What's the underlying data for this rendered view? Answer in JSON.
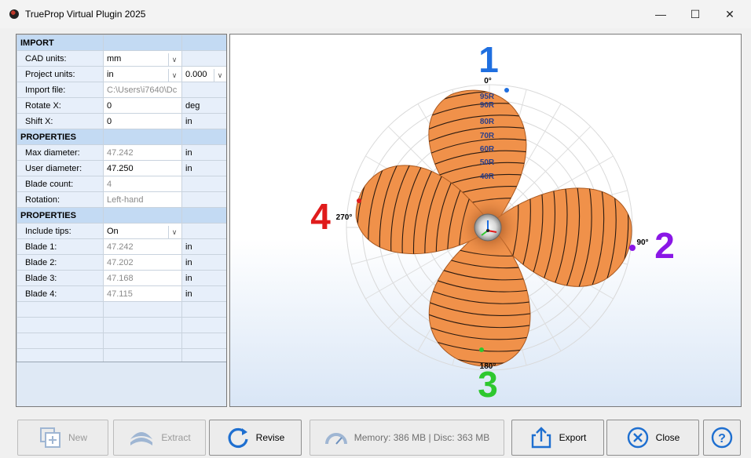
{
  "window": {
    "title": "TrueProp Virtual Plugin 2025"
  },
  "titlebar_buttons": {
    "minimize": "—",
    "maximize": "☐",
    "close": "✕"
  },
  "property_grid": {
    "rows": [
      {
        "type": "section",
        "label": "IMPORT"
      },
      {
        "type": "field",
        "label": "CAD units:",
        "value": "mm",
        "dropdown": true,
        "unit": ""
      },
      {
        "type": "field",
        "label": "Project units:",
        "value": "in",
        "dropdown": true,
        "unit": "0.000",
        "unit_dropdown": true
      },
      {
        "type": "field",
        "label": "Import file:",
        "value": "C:\\Users\\i7640\\Dc",
        "readonly": true,
        "unit": ""
      },
      {
        "type": "field",
        "label": "Rotate X:",
        "value": "0",
        "unit": "deg"
      },
      {
        "type": "field",
        "label": "Shift X:",
        "value": "0",
        "unit": "in"
      },
      {
        "type": "section",
        "label": "PROPERTIES"
      },
      {
        "type": "field",
        "label": "Max diameter:",
        "value": "47.242",
        "readonly": true,
        "unit": "in"
      },
      {
        "type": "field",
        "label": "User diameter:",
        "value": "47.250",
        "unit": "in"
      },
      {
        "type": "field",
        "label": "Blade count:",
        "value": "4",
        "readonly": true,
        "unit": ""
      },
      {
        "type": "field",
        "label": "Rotation:",
        "value": "Left-hand",
        "readonly": true,
        "unit": ""
      },
      {
        "type": "section",
        "label": "PROPERTIES"
      },
      {
        "type": "field",
        "label": "Include tips:",
        "value": "On",
        "dropdown": true,
        "unit": ""
      },
      {
        "type": "field",
        "label": "Blade 1:",
        "value": "47.242",
        "readonly": true,
        "unit": "in"
      },
      {
        "type": "field",
        "label": "Blade 2:",
        "value": "47.202",
        "readonly": true,
        "unit": "in"
      },
      {
        "type": "field",
        "label": "Blade 3:",
        "value": "47.168",
        "readonly": true,
        "unit": "in"
      },
      {
        "type": "field",
        "label": "Blade 4:",
        "value": "47.115",
        "readonly": true,
        "unit": "in"
      },
      {
        "type": "empty"
      },
      {
        "type": "empty"
      },
      {
        "type": "empty"
      },
      {
        "type": "empty"
      }
    ]
  },
  "viewport": {
    "blade_numbers": [
      "1",
      "2",
      "3",
      "4"
    ],
    "blade_colors": [
      "#1f6fe0",
      "#8a17e6",
      "#2ec82e",
      "#e01b1b"
    ],
    "angle_labels": [
      "0°",
      "90°",
      "180°",
      "270°"
    ],
    "radius_labels": [
      "95R",
      "90R",
      "80R",
      "70R",
      "60R",
      "50R",
      "40R"
    ],
    "blade_color": "#f0914a"
  },
  "toolbar": {
    "new": "New",
    "extract": "Extract",
    "revise": "Revise",
    "memory": "Memory: 386 MB | Disc: 363 MB",
    "export": "Export",
    "close": "Close"
  }
}
